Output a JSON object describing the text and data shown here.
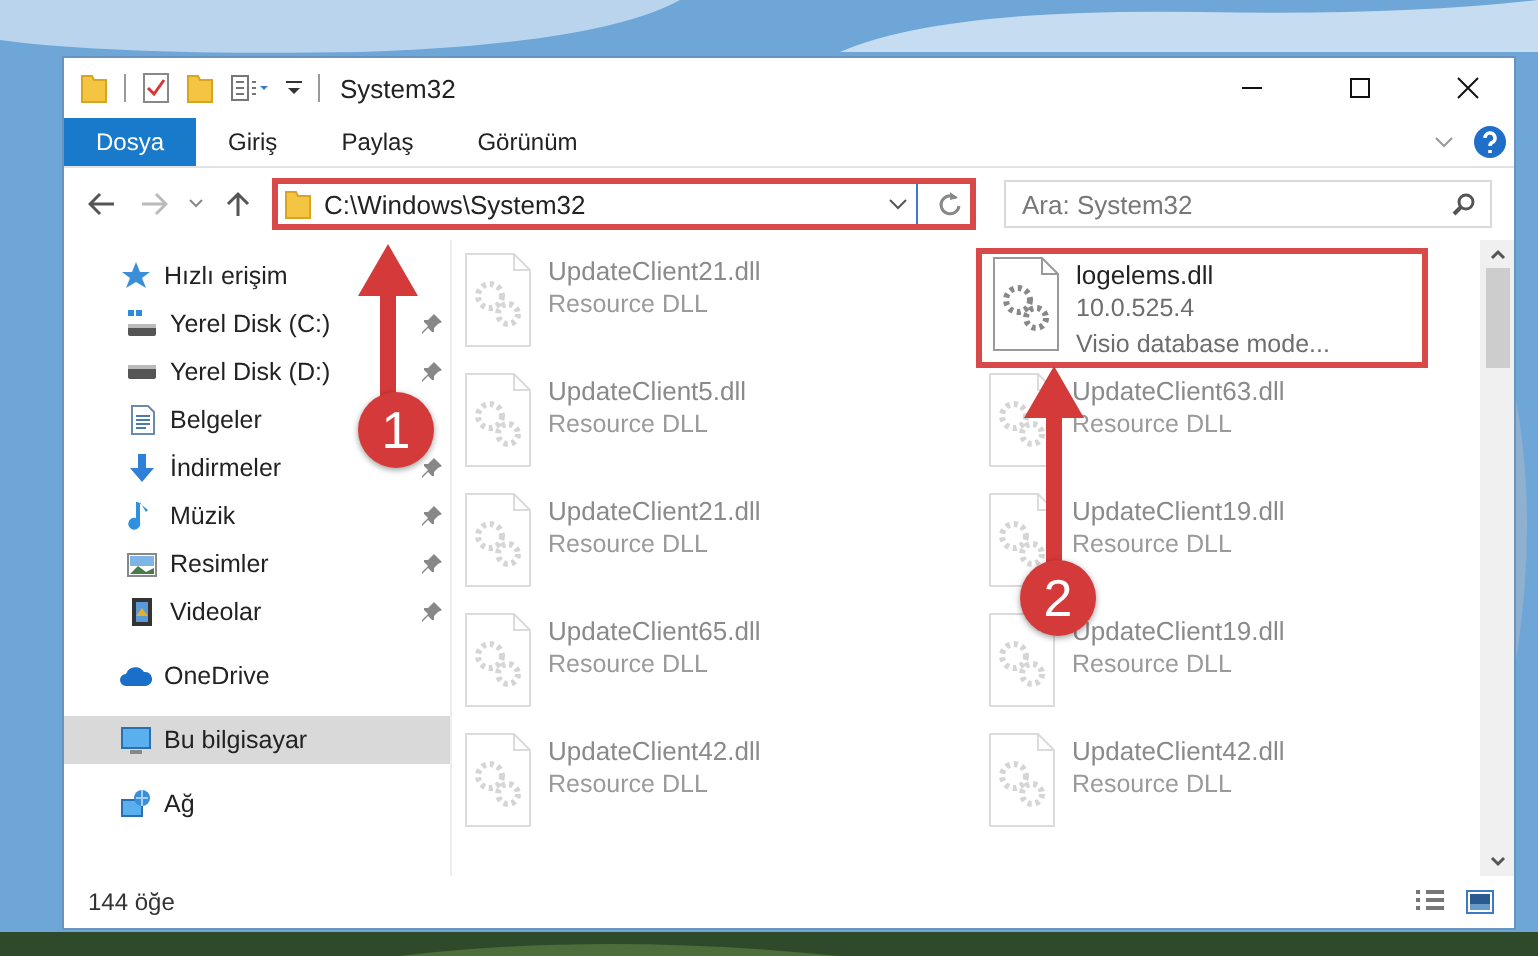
{
  "window": {
    "title": "System32"
  },
  "ribbon": {
    "tabs": [
      {
        "label": "Dosya",
        "selected": true
      },
      {
        "label": "Giriş",
        "selected": false
      },
      {
        "label": "Paylaş",
        "selected": false
      },
      {
        "label": "Görünüm",
        "selected": false
      }
    ]
  },
  "address_bar": {
    "path": "C:\\Windows\\System32",
    "highlighted": true
  },
  "search": {
    "placeholder": "Ara: System32"
  },
  "navigation": [
    {
      "label": "Hızlı erişim",
      "selected": false,
      "children": [
        {
          "label": "Yerel Disk (C:)",
          "pinned": true,
          "selected": false
        },
        {
          "label": "Yerel Disk (D:)",
          "pinned": true,
          "selected": false
        },
        {
          "label": "Belgeler",
          "pinned": false,
          "selected": false
        },
        {
          "label": "İndirmeler",
          "pinned": true,
          "selected": false
        },
        {
          "label": "Müzik",
          "pinned": true,
          "selected": false
        },
        {
          "label": "Resimler",
          "pinned": true,
          "selected": false
        },
        {
          "label": "Videolar",
          "pinned": true,
          "selected": false
        }
      ]
    },
    {
      "label": "OneDrive",
      "selected": false
    },
    {
      "label": "Bu bilgisayar",
      "selected": true
    },
    {
      "label": "Ağ",
      "selected": false
    }
  ],
  "files": [
    {
      "name": "UpdateClient21.dll",
      "details": [
        "Resource DLL"
      ],
      "faded": true,
      "highlighted": false
    },
    {
      "name": "logelems.dll",
      "details": [
        "10.0.525.4",
        "Visio database mode..."
      ],
      "faded": false,
      "highlighted": true
    },
    {
      "name": "UpdateClient5.dll",
      "details": [
        "Resource DLL"
      ],
      "faded": true,
      "highlighted": false
    },
    {
      "name": "UpdateClient63.dll",
      "details": [
        "Resource DLL"
      ],
      "faded": true,
      "highlighted": false
    },
    {
      "name": "UpdateClient21.dll",
      "details": [
        "Resource DLL"
      ],
      "faded": true,
      "highlighted": false
    },
    {
      "name": "UpdateClient19.dll",
      "details": [
        "Resource DLL"
      ],
      "faded": true,
      "highlighted": false
    },
    {
      "name": "UpdateClient65.dll",
      "details": [
        "Resource DLL"
      ],
      "faded": true,
      "highlighted": false
    },
    {
      "name": "UpdateClient19.dll",
      "details": [
        "Resource DLL"
      ],
      "faded": true,
      "highlighted": false
    },
    {
      "name": "UpdateClient42.dll",
      "details": [
        "Resource DLL"
      ],
      "faded": true,
      "highlighted": false
    },
    {
      "name": "UpdateClient42.dll",
      "details": [
        "Resource DLL"
      ],
      "faded": true,
      "highlighted": false
    }
  ],
  "status_bar": {
    "item_count": "144 öğe"
  },
  "callouts": [
    {
      "label": "1"
    },
    {
      "label": "2"
    }
  ]
}
